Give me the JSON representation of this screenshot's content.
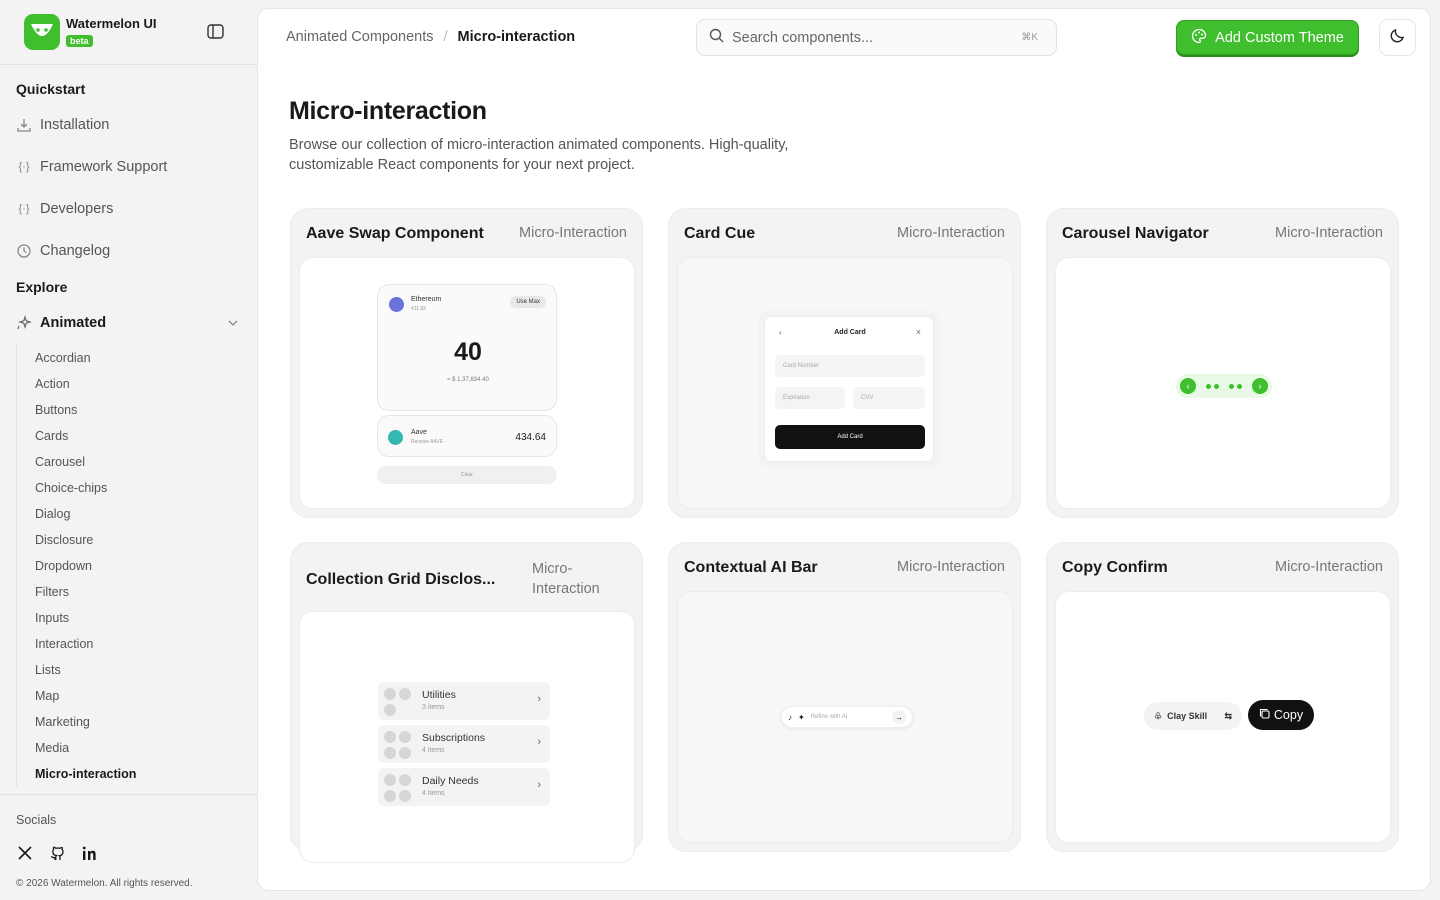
{
  "brand": {
    "name": "Watermelon UI",
    "badge": "beta"
  },
  "sidebar": {
    "quickstart_heading": "Quickstart",
    "quickstart_items": [
      {
        "label": "Installation",
        "icon": "download-icon"
      },
      {
        "label": "Framework Support",
        "icon": "code-braces-icon"
      },
      {
        "label": "Developers",
        "icon": "code-braces-icon"
      },
      {
        "label": "Changelog",
        "icon": "clock-icon"
      }
    ],
    "explore_heading": "Explore",
    "animated_label": "Animated",
    "animated_items": [
      "Accordian",
      "Action",
      "Buttons",
      "Cards",
      "Carousel",
      "Choice-chips",
      "Dialog",
      "Disclosure",
      "Dropdown",
      "Filters",
      "Inputs",
      "Interaction",
      "Lists",
      "Map",
      "Marketing",
      "Media",
      "Micro-interaction"
    ],
    "active_item": "Micro-interaction",
    "socials_label": "Socials",
    "copyright": "© 2026 Watermelon. All rights reserved."
  },
  "header": {
    "breadcrumb": [
      "Animated Components",
      "Micro-interaction"
    ],
    "search_placeholder": "Search components...",
    "search_shortcut": "⌘K",
    "add_theme_label": "Add Custom Theme"
  },
  "page": {
    "title": "Micro-interaction",
    "description": "Browse our collection of micro-interaction animated components. High-quality, customizable React components for your next project."
  },
  "cards": [
    {
      "title": "Aave Swap Component",
      "tag": "Micro-Interaction"
    },
    {
      "title": "Card Cue",
      "tag": "Micro-Interaction"
    },
    {
      "title": "Carousel Navigator",
      "tag": "Micro-Interaction"
    },
    {
      "title": "Collection Grid Disclos...",
      "tag": "Micro-Interaction"
    },
    {
      "title": "Contextual AI Bar",
      "tag": "Micro-Interaction"
    },
    {
      "title": "Copy Confirm",
      "tag": "Micro-Interaction"
    }
  ],
  "aave_preview": {
    "token": "Ethereum",
    "token_balance": "411.82",
    "use_max": "Use Max",
    "amount": "40",
    "usd": "≈ $ 1,37,834.40",
    "receive_token": "Aave",
    "receive_sub": "Receive AAVE",
    "receive_value": "434.64",
    "clear": "Clear"
  },
  "cardcue_preview": {
    "title": "Add Card",
    "card_number": "Card Number",
    "expiration": "Expiration",
    "cvv": "CVV",
    "button": "Add Card"
  },
  "collection_preview": [
    {
      "name": "Utilities",
      "count": "3 items"
    },
    {
      "name": "Subscriptions",
      "count": "4 items"
    },
    {
      "name": "Daily Needs",
      "count": "4 items"
    }
  ],
  "ai_bar_preview": {
    "placeholder": "Refine with AI"
  },
  "copy_preview": {
    "skill": "Clay Skill",
    "copy": "Copy"
  },
  "colors": {
    "accent": "#3fbf2e",
    "text": "#1a1a1a",
    "muted": "#555555"
  }
}
